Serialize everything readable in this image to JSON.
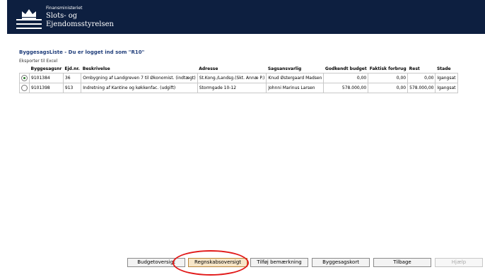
{
  "header": {
    "ministry": "Finansministeriet",
    "agency_line1": "Slots- og",
    "agency_line2": "Ejendomsstyrelsen"
  },
  "page": {
    "title": "ByggesagsListe - Du er logget ind som \"R10\"",
    "export_link": "Eksporter til Excel"
  },
  "table": {
    "columns": [
      "Byggesagsnr",
      "Ejd.nr.",
      "Beskrivelse",
      "Adresse",
      "Sagsansvarlig",
      "Godkendt budget",
      "Faktisk forbrug",
      "Rest",
      "Stade"
    ],
    "rows": [
      {
        "selected": true,
        "nr": "9101384",
        "ejd": "36",
        "beskrivelse": "Ombygning af Landgreven 7 til Økonomist. (indtægt)",
        "adresse": "St.Kong./Landsg.(Skt. Annæ P.)",
        "ansvarlig": "Knud Østergaard Madsen",
        "budget": "0,00",
        "forbrug": "0,00",
        "rest": "0,00",
        "stade": "Igangsat"
      },
      {
        "selected": false,
        "nr": "9101398",
        "ejd": "913",
        "beskrivelse": "Indretning af Kantine og køkkenfac. (udgift)",
        "adresse": "Stormgade 10-12",
        "ansvarlig": "Johnni Marinus Larsen",
        "budget": "578.000,00",
        "forbrug": "0,00",
        "rest": "578.000,00",
        "stade": "Igangsat"
      }
    ]
  },
  "buttons": {
    "budget": "Budgetoversigt",
    "regnskab": "Regnskabsoversigt",
    "bemaerkning": "Tilføj bemærkning",
    "byggesagskort": "Byggesagskort",
    "tilbage": "Tilbage",
    "hjaelp": "Hjælp"
  },
  "colors": {
    "header_bg": "#0d1f40",
    "title_text": "#1f3d7a",
    "highlight_ring": "#e21a1a"
  }
}
